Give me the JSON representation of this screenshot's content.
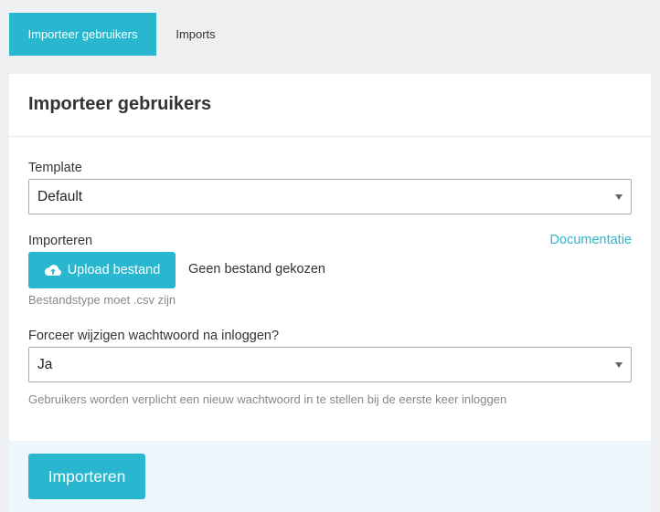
{
  "tabs": [
    {
      "label": "Importeer gebruikers",
      "active": true
    },
    {
      "label": "Imports",
      "active": false
    }
  ],
  "card": {
    "title": "Importeer gebruikers"
  },
  "template_field": {
    "label": "Template",
    "value": "Default"
  },
  "import_field": {
    "label": "Importeren",
    "doc_link": "Documentatie",
    "upload_button": "Upload bestand",
    "upload_icon": "cloud-upload-icon",
    "no_file_text": "Geen bestand gekozen",
    "help": "Bestandstype moet .csv zijn"
  },
  "force_password_field": {
    "label": "Forceer wijzigen wachtwoord na inloggen?",
    "value": "Ja",
    "help": "Gebruikers worden verplicht een nieuw wachtwoord in te stellen bij de eerste keer inloggen"
  },
  "footer": {
    "submit_button": "Importeren"
  },
  "colors": {
    "accent": "#29b6cf",
    "background": "#eff0f2",
    "footer_bg": "#edf6fb"
  }
}
